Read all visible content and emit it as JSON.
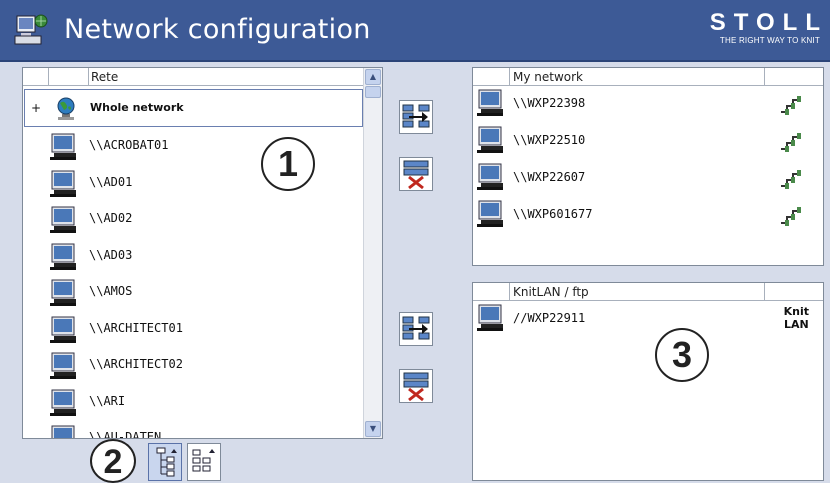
{
  "header": {
    "title": "Network configuration",
    "brand_name": "STOLL",
    "brand_tagline": "THE RIGHT WAY TO KNIT",
    "icon": "network-computer-icon"
  },
  "left_panel": {
    "column_header": "Rete",
    "whole_network": {
      "expander": "+",
      "label": "Whole network"
    },
    "computers": [
      "\\\\ACROBAT01",
      "\\\\AD01",
      "\\\\AD02",
      "\\\\AD03",
      "\\\\AMOS",
      "\\\\ARCHITECT01",
      "\\\\ARCHITECT02",
      "\\\\ARI",
      "\\\\AU-DATEN"
    ]
  },
  "my_network": {
    "column_header": "My network",
    "computers": [
      "\\\\WXP22398",
      "\\\\WXP22510",
      "\\\\WXP22607",
      "\\\\WXP601677"
    ]
  },
  "knitlan": {
    "column_header": "KnitLAN / ftp",
    "computers": [
      "//WXP22911"
    ],
    "type_label_line1": "Knit",
    "type_label_line2": "LAN"
  },
  "callouts": {
    "one": "1",
    "two": "2",
    "three": "3"
  },
  "colors": {
    "header_bg": "#3d5a96",
    "body_bg": "#d6dcea",
    "selected_view": "#c9d6ee"
  }
}
